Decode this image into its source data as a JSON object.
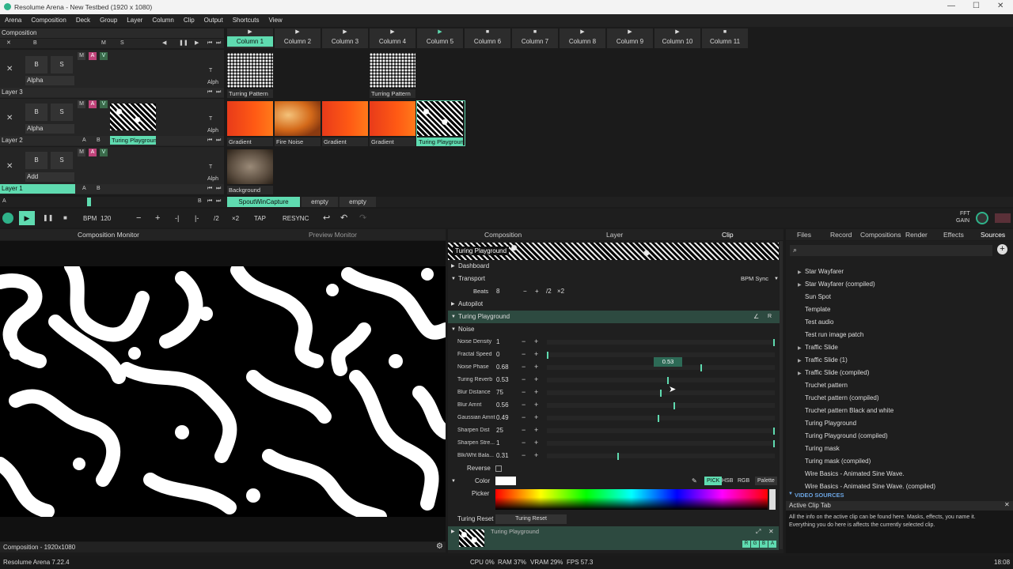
{
  "window": {
    "title": "Resolume Arena - New Testbed (1920 x 1080)",
    "minimize": "—",
    "maximize": "☐",
    "close": "✕"
  },
  "menu": [
    "Arena",
    "Composition",
    "Deck",
    "Group",
    "Layer",
    "Column",
    "Clip",
    "Output",
    "Shortcuts",
    "View"
  ],
  "composition": {
    "label": "Composition",
    "ctrl": {
      "x": "✕",
      "b": "B",
      "m": "M",
      "s": "S"
    },
    "columns": [
      {
        "name": "Column 1",
        "icon": "play"
      },
      {
        "name": "Column 2",
        "icon": "play"
      },
      {
        "name": "Column 3",
        "icon": "play"
      },
      {
        "name": "Column 4",
        "icon": "play"
      },
      {
        "name": "Column 5",
        "icon": "play"
      },
      {
        "name": "Column 6",
        "icon": "stop"
      },
      {
        "name": "Column 7",
        "icon": "stop"
      },
      {
        "name": "Column 8",
        "icon": "play"
      },
      {
        "name": "Column 9",
        "icon": "play"
      },
      {
        "name": "Column 10",
        "icon": "play"
      },
      {
        "name": "Column 11",
        "icon": "stop"
      }
    ]
  },
  "layers": {
    "layer3": {
      "name": "Layer 3",
      "blend": "Alpha",
      "clips": {
        "c1": "Turring Pattern",
        "c4": "Turring Pattern"
      }
    },
    "layer2": {
      "name": "Layer 2",
      "blend": "Alpha",
      "preview": "Turing Playground",
      "clips": {
        "c1": "Gradient",
        "c2": "Fire Noise",
        "c3": "Gradient",
        "c4": "Gradient",
        "c5": "Turing Playground"
      }
    },
    "layer1": {
      "name": "Layer 1",
      "blend": "Add",
      "clips": {
        "c1": "Background"
      }
    },
    "common": {
      "b": "B",
      "s": "S",
      "m": "M",
      "a": "A",
      "v": "V",
      "t": "T",
      "alph": "Alph",
      "ab_a": "A",
      "ab_b": "B"
    }
  },
  "deck": {
    "a": "A",
    "b": "B",
    "tabs": [
      "SpoutWinCapture",
      "empty",
      "empty"
    ]
  },
  "transport": {
    "bpm_label": "BPM",
    "bpm": "120",
    "minus": "−",
    "plus": "+",
    "half": "/2",
    "double": "×2",
    "tap": "TAP",
    "resync": "RESYNC",
    "fft": "FFT",
    "gain": "GAIN"
  },
  "monitors": {
    "composition": "Composition Monitor",
    "preview": "Preview Monitor",
    "footer": "Composition - 1920x1080"
  },
  "panel_tabs": {
    "composition": "Composition",
    "layer": "Layer",
    "clip": "Clip"
  },
  "clip_panel": {
    "clip_name": "Turing Playground",
    "dashboard": "Dashboard",
    "transport": "Transport",
    "bpm_sync": "BPM Sync",
    "beats_label": "Beats",
    "beats": "8",
    "half": "/2",
    "double": "×2",
    "autopilot": "Autopilot",
    "effect": "Turing Playground",
    "noise": "Noise",
    "tooltip": "0.53",
    "params": [
      {
        "name": "Noise Density",
        "value": "1",
        "pos": 1.0
      },
      {
        "name": "Fractal Speed",
        "value": "0",
        "pos": 0.0
      },
      {
        "name": "Noise Phase",
        "value": "0.68",
        "pos": 0.68
      },
      {
        "name": "Turing Reverb",
        "value": "0.53",
        "pos": 0.53
      },
      {
        "name": "Blur Distance",
        "value": "75",
        "pos": 0.5
      },
      {
        "name": "Blur Amnt",
        "value": "0.56",
        "pos": 0.56
      },
      {
        "name": "Gaussian Amnt",
        "value": "0.49",
        "pos": 0.49
      },
      {
        "name": "Sharpen Dist",
        "value": "25",
        "pos": 1.0
      },
      {
        "name": "Sharpen Stre...",
        "value": "1",
        "pos": 1.0
      },
      {
        "name": "Blk/Wht Bala...",
        "value": "0.31",
        "pos": 0.31
      }
    ],
    "reverse": "Reverse",
    "color": "Color",
    "pick": "PICK",
    "hsb": "HSB",
    "rgb": "RGB",
    "palette": "Palette",
    "picker": "Picker",
    "turing_reset_label": "Turing Reset",
    "turing_reset_btn": "Turing Reset",
    "footer_clip": "Turing Playground",
    "rgba": [
      "R",
      "G",
      "B",
      "A"
    ]
  },
  "sources": {
    "tabs": [
      "Files",
      "Record",
      "Compositions",
      "Render",
      "Effects",
      "Sources"
    ],
    "items": [
      {
        "name": "Star Wayfarer",
        "arrow": true
      },
      {
        "name": "Star Wayfarer (compiled)",
        "arrow": true
      },
      {
        "name": "Sun Spot",
        "arrow": false
      },
      {
        "name": "Template",
        "arrow": false
      },
      {
        "name": "Test audio",
        "arrow": false
      },
      {
        "name": "Test run image patch",
        "arrow": false
      },
      {
        "name": "Traffic Slide",
        "arrow": true
      },
      {
        "name": "Traffic Slide (1)",
        "arrow": true
      },
      {
        "name": "Traffic Slide (compiled)",
        "arrow": true
      },
      {
        "name": "Truchet pattern",
        "arrow": false
      },
      {
        "name": "Truchet pattern (compiled)",
        "arrow": false
      },
      {
        "name": "Truchet pattern Black and white",
        "arrow": false
      },
      {
        "name": "Turing Playground",
        "arrow": false
      },
      {
        "name": "Turing Playground (compiled)",
        "arrow": false
      },
      {
        "name": "Turing mask",
        "arrow": false
      },
      {
        "name": "Turing mask (compiled)",
        "arrow": false
      },
      {
        "name": "Wire Basics - Animated Sine Wave.",
        "arrow": false
      },
      {
        "name": "Wire Basics - Animated Sine Wave. (compiled)",
        "arrow": false
      }
    ],
    "video_sources": "VIDEO SOURCES",
    "help_title": "Active Clip Tab",
    "help_text": "All the info on the active clip can be found here. Masks, effects, you name it. Everything you do here is affects the currently selected clip."
  },
  "status": {
    "version": "Resolume Arena 7.22.4",
    "cpu": "CPU 0%",
    "ram": "RAM 37%",
    "vram": "VRAM 29%",
    "fps": "FPS 57.3",
    "time": "18:08"
  },
  "colors": {
    "accent": "#5fdbb0",
    "pink": "#c0437a"
  }
}
